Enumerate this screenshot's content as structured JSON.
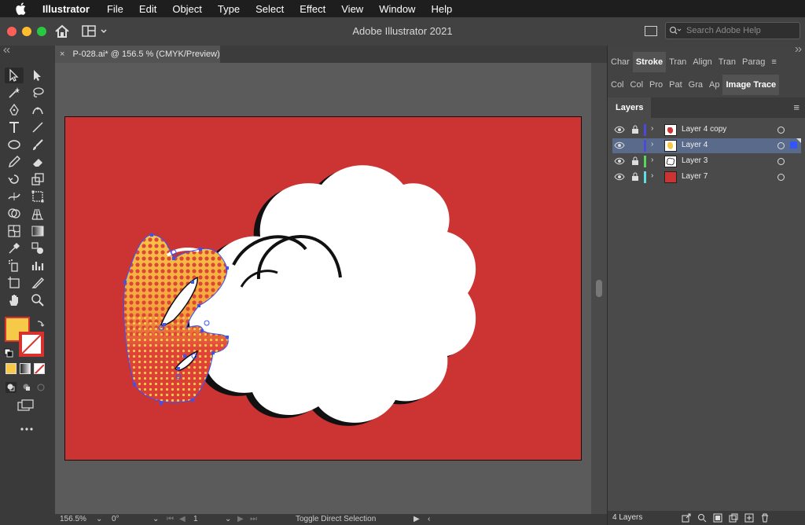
{
  "menubar": {
    "app_name": "Illustrator",
    "items": [
      "File",
      "Edit",
      "Object",
      "Type",
      "Select",
      "Effect",
      "View",
      "Window",
      "Help"
    ]
  },
  "appbar": {
    "title": "Adobe Illustrator 2021",
    "search_placeholder": "Search Adobe Help"
  },
  "document": {
    "tab_label": "P-028.ai* @ 156.5 % (CMYK/Preview)",
    "close_glyph": "×"
  },
  "panels": {
    "row1_tabs": [
      "Char",
      "Stroke",
      "Tran",
      "Align",
      "Tran",
      "Parag"
    ],
    "row1_active": "Stroke",
    "row2_tabs": [
      "Col",
      "Col",
      "Pro",
      "Pat",
      "Gra",
      "Ap",
      "Image Trace"
    ],
    "row2_active": "Image Trace"
  },
  "layers": {
    "title": "Layers",
    "items": [
      {
        "name": "Layer 4 copy",
        "color": "#4a4adc",
        "selected": false
      },
      {
        "name": "Layer 4",
        "color": "#4a4adc",
        "selected": true
      },
      {
        "name": "Layer 3",
        "color": "#57d957",
        "selected": false
      },
      {
        "name": "Layer 7",
        "color": "#5ee0e0",
        "selected": false
      }
    ],
    "count_label": "4 Layers"
  },
  "status": {
    "zoom": "156.5%",
    "rotation": "0°",
    "artboard": "1",
    "tool": "Toggle Direct Selection"
  },
  "colors": {
    "fill": "#f7c948",
    "artboard_bg": "#cc3333",
    "selection": "#3355ff"
  },
  "icons": [
    "apple-icon",
    "home-icon",
    "workspace-icon",
    "search-icon",
    "eye-icon",
    "lock-icon",
    "chevron-right-icon",
    "new-layer-icon",
    "trash-icon"
  ]
}
